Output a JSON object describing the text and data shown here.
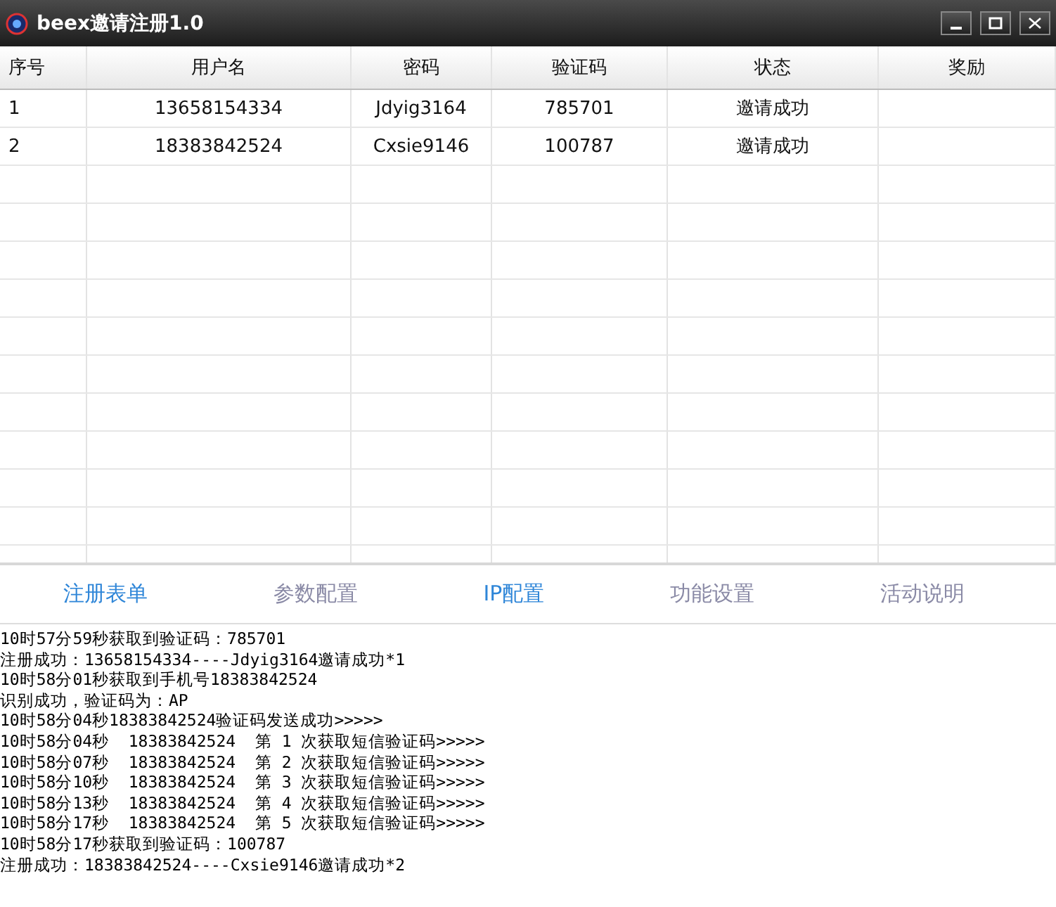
{
  "window": {
    "title": "beex邀请注册1.0"
  },
  "table": {
    "columns": [
      "序号",
      "用户名",
      "密码",
      "验证码",
      "状态",
      "奖励"
    ],
    "rows": [
      [
        "1",
        "13658154334",
        "Jdyig3164",
        "785701",
        "邀请成功",
        ""
      ],
      [
        "2",
        "18383842524",
        "Cxsie9146",
        "100787",
        "邀请成功",
        ""
      ]
    ]
  },
  "tabs": [
    {
      "label": "注册表单",
      "color": "#2f86d8"
    },
    {
      "label": "参数配置",
      "color": "#8a8aa6"
    },
    {
      "label": "IP配置",
      "color": "#2f86d8"
    },
    {
      "label": "功能设置",
      "color": "#8a8aa6"
    },
    {
      "label": "活动说明",
      "color": "#8a8aa6"
    }
  ],
  "log": [
    "10时57分59秒获取到验证码：785701",
    "注册成功：13658154334----Jdyig3164邀请成功*1",
    "10时58分01秒获取到手机号18383842524",
    "识别成功，验证码为：AP",
    "10时58分04秒18383842524验证码发送成功>>>>>",
    "10时58分04秒  18383842524  第 1 次获取短信验证码>>>>>",
    "10时58分07秒  18383842524  第 2 次获取短信验证码>>>>>",
    "10时58分10秒  18383842524  第 3 次获取短信验证码>>>>>",
    "10时58分13秒  18383842524  第 4 次获取短信验证码>>>>>",
    "10时58分17秒  18383842524  第 5 次获取短信验证码>>>>>",
    "10时58分17秒获取到验证码：100787",
    "注册成功：18383842524----Cxsie9146邀请成功*2"
  ]
}
